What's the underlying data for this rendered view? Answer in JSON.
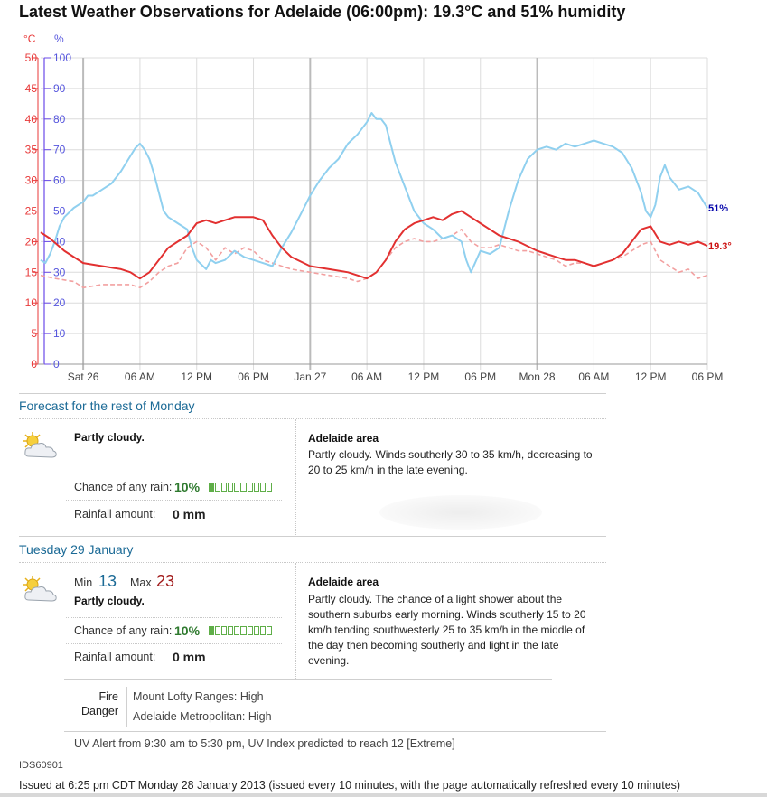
{
  "title": "Latest Weather Observations for Adelaide (06:00pm): 19.3°C and 51% humidity",
  "chart_data": {
    "type": "line",
    "y_left": {
      "unit": "°C",
      "ticks": [
        0,
        5,
        10,
        15,
        20,
        25,
        30,
        35,
        40,
        45,
        50
      ],
      "range": [
        0,
        50
      ],
      "color": "#e83a3a"
    },
    "y_right": {
      "unit": "%",
      "ticks": [
        0,
        10,
        20,
        30,
        40,
        50,
        60,
        70,
        80,
        90,
        100
      ],
      "range": [
        0,
        100
      ],
      "color": "#5555dd"
    },
    "x_unit": "hours since Sat 26 00:00",
    "x_range": [
      -4.5,
      66
    ],
    "x_ticks": [
      {
        "h": 0,
        "label": "Sat 26"
      },
      {
        "h": 6,
        "label": "06 AM"
      },
      {
        "h": 12,
        "label": "12 PM"
      },
      {
        "h": 18,
        "label": "06 PM"
      },
      {
        "h": 24,
        "label": "Jan 27"
      },
      {
        "h": 30,
        "label": "06 AM"
      },
      {
        "h": 36,
        "label": "12 PM"
      },
      {
        "h": 42,
        "label": "06 PM"
      },
      {
        "h": 48,
        "label": "Mon 28"
      },
      {
        "h": 54,
        "label": "06 AM"
      },
      {
        "h": 60,
        "label": "12 PM"
      },
      {
        "h": 66,
        "label": "06 PM"
      }
    ],
    "grid": true,
    "end_labels": {
      "humidity": "51%",
      "temperature": "19.3°"
    },
    "series": [
      {
        "axis": "left",
        "color": "#e23030",
        "style": "solid",
        "points": [
          [
            -4.5,
            21.5
          ],
          [
            -3.5,
            20.5
          ],
          [
            -2,
            18.5
          ],
          [
            0,
            16.5
          ],
          [
            2,
            16
          ],
          [
            4,
            15.5
          ],
          [
            5,
            15
          ],
          [
            6,
            14
          ],
          [
            7,
            15
          ],
          [
            8,
            17
          ],
          [
            9,
            19
          ],
          [
            10,
            20
          ],
          [
            11,
            21
          ],
          [
            12,
            23
          ],
          [
            13,
            23.5
          ],
          [
            14,
            23
          ],
          [
            15,
            23.5
          ],
          [
            16,
            24
          ],
          [
            17,
            24
          ],
          [
            18,
            24
          ],
          [
            19,
            23.5
          ],
          [
            20,
            21
          ],
          [
            21,
            19
          ],
          [
            22,
            17.5
          ],
          [
            24,
            16
          ],
          [
            26,
            15.5
          ],
          [
            28,
            15
          ],
          [
            30,
            14
          ],
          [
            31,
            15
          ],
          [
            32,
            17
          ],
          [
            33,
            20
          ],
          [
            34,
            22
          ],
          [
            35,
            23
          ],
          [
            36,
            23.5
          ],
          [
            37,
            24
          ],
          [
            38,
            23.5
          ],
          [
            39,
            24.5
          ],
          [
            40,
            25
          ],
          [
            41,
            24
          ],
          [
            42,
            23
          ],
          [
            43,
            22
          ],
          [
            44,
            21
          ],
          [
            46,
            20
          ],
          [
            48,
            18.5
          ],
          [
            49,
            18
          ],
          [
            50,
            17.5
          ],
          [
            51,
            17
          ],
          [
            52,
            17
          ],
          [
            53,
            16.5
          ],
          [
            54,
            16
          ],
          [
            55,
            16.5
          ],
          [
            56,
            17
          ],
          [
            57,
            18
          ],
          [
            58,
            20
          ],
          [
            59,
            22
          ],
          [
            60,
            22.5
          ],
          [
            61,
            20
          ],
          [
            62,
            19.5
          ],
          [
            63,
            20
          ],
          [
            64,
            19.5
          ],
          [
            65,
            20
          ],
          [
            66,
            19.3
          ]
        ]
      },
      {
        "axis": "left",
        "color": "#f2a0a0",
        "style": "dashed",
        "points": [
          [
            -4.5,
            14.5
          ],
          [
            -3,
            14
          ],
          [
            -1,
            13.5
          ],
          [
            0,
            12.5
          ],
          [
            2,
            13
          ],
          [
            4,
            13
          ],
          [
            5,
            13
          ],
          [
            6,
            12.5
          ],
          [
            7,
            13.5
          ],
          [
            8,
            15
          ],
          [
            9,
            16
          ],
          [
            10,
            16.5
          ],
          [
            11,
            19
          ],
          [
            12,
            20
          ],
          [
            13,
            19
          ],
          [
            14,
            17
          ],
          [
            15,
            19
          ],
          [
            16,
            18
          ],
          [
            17,
            19
          ],
          [
            18,
            18.5
          ],
          [
            19,
            17
          ],
          [
            20,
            16.5
          ],
          [
            21,
            16
          ],
          [
            22,
            15.5
          ],
          [
            24,
            15
          ],
          [
            26,
            14.5
          ],
          [
            28,
            14
          ],
          [
            29,
            13.5
          ],
          [
            30,
            14
          ],
          [
            31,
            15
          ],
          [
            32,
            17
          ],
          [
            33,
            19
          ],
          [
            34,
            20
          ],
          [
            35,
            20.5
          ],
          [
            36,
            20
          ],
          [
            37,
            20
          ],
          [
            38,
            20.5
          ],
          [
            39,
            21
          ],
          [
            40,
            22
          ],
          [
            41,
            20
          ],
          [
            42,
            19
          ],
          [
            43,
            19
          ],
          [
            44,
            19.5
          ],
          [
            45,
            19
          ],
          [
            46,
            18.5
          ],
          [
            47,
            18.5
          ],
          [
            48,
            18
          ],
          [
            49,
            17.5
          ],
          [
            50,
            17
          ],
          [
            51,
            16
          ],
          [
            52,
            16.5
          ],
          [
            53,
            16.5
          ],
          [
            54,
            16
          ],
          [
            55,
            16.5
          ],
          [
            56,
            17
          ],
          [
            57,
            17.5
          ],
          [
            58,
            18.5
          ],
          [
            59,
            19.5
          ],
          [
            60,
            20
          ],
          [
            61,
            17
          ],
          [
            62,
            16
          ],
          [
            63,
            15
          ],
          [
            64,
            15.5
          ],
          [
            65,
            14
          ],
          [
            66,
            14.5
          ]
        ]
      },
      {
        "axis": "right",
        "color": "#90d0ef",
        "style": "solid",
        "points": [
          [
            -4.5,
            34
          ],
          [
            -4,
            33
          ],
          [
            -3.5,
            36
          ],
          [
            -3,
            40
          ],
          [
            -2.5,
            45
          ],
          [
            -2,
            48
          ],
          [
            -1,
            51
          ],
          [
            0,
            53
          ],
          [
            0.5,
            55
          ],
          [
            1,
            55
          ],
          [
            2,
            57
          ],
          [
            3,
            59
          ],
          [
            4,
            63
          ],
          [
            5,
            68
          ],
          [
            5.5,
            70.5
          ],
          [
            6,
            72
          ],
          [
            6.5,
            70
          ],
          [
            7,
            67
          ],
          [
            7.5,
            62
          ],
          [
            8,
            56
          ],
          [
            8.5,
            50
          ],
          [
            9,
            48
          ],
          [
            10,
            46
          ],
          [
            11,
            44
          ],
          [
            11.5,
            38
          ],
          [
            12,
            34
          ],
          [
            13,
            31
          ],
          [
            13.5,
            34
          ],
          [
            14,
            33
          ],
          [
            15,
            34
          ],
          [
            16,
            37
          ],
          [
            17,
            35
          ],
          [
            18,
            34
          ],
          [
            19,
            33
          ],
          [
            20,
            32
          ],
          [
            21,
            38
          ],
          [
            22,
            43
          ],
          [
            23,
            49
          ],
          [
            24,
            55
          ],
          [
            25,
            60
          ],
          [
            26,
            64
          ],
          [
            27,
            67
          ],
          [
            28,
            72
          ],
          [
            29,
            75
          ],
          [
            30,
            79
          ],
          [
            30.5,
            82
          ],
          [
            31,
            80
          ],
          [
            31.5,
            80
          ],
          [
            32,
            78
          ],
          [
            32.5,
            72
          ],
          [
            33,
            66
          ],
          [
            34,
            58
          ],
          [
            35,
            50
          ],
          [
            36,
            46
          ],
          [
            37,
            44
          ],
          [
            38,
            41
          ],
          [
            39,
            42
          ],
          [
            40,
            40
          ],
          [
            40.5,
            34
          ],
          [
            41,
            30
          ],
          [
            42,
            37
          ],
          [
            43,
            36
          ],
          [
            44,
            38
          ],
          [
            45,
            50
          ],
          [
            46,
            60
          ],
          [
            47,
            67
          ],
          [
            48,
            70
          ],
          [
            49,
            71
          ],
          [
            50,
            70
          ],
          [
            51,
            72
          ],
          [
            52,
            71
          ],
          [
            53,
            72
          ],
          [
            54,
            73
          ],
          [
            55,
            72
          ],
          [
            56,
            71
          ],
          [
            57,
            69
          ],
          [
            58,
            64
          ],
          [
            59,
            56
          ],
          [
            59.5,
            50
          ],
          [
            60,
            48
          ],
          [
            60.5,
            52
          ],
          [
            61,
            61
          ],
          [
            61.5,
            65
          ],
          [
            62,
            61
          ],
          [
            63,
            57
          ],
          [
            64,
            58
          ],
          [
            65,
            56
          ],
          [
            66,
            51
          ]
        ]
      }
    ]
  },
  "forecast": {
    "monday": {
      "heading": "Forecast for the rest of Monday",
      "icon": "partly-cloudy-icon",
      "summary": "Partly cloudy.",
      "rain_chance_label": "Chance of any rain:",
      "rain_chance": "10%",
      "rain_chance_fraction": 0.1,
      "rain_amount_label": "Rainfall amount:",
      "rain_amount": "0 mm",
      "area_title": "Adelaide area",
      "area_text": "Partly cloudy. Winds southerly 30 to 35 km/h, decreasing to 20 to 25 km/h in the late evening."
    },
    "tuesday": {
      "heading": "Tuesday 29 January",
      "icon": "partly-cloudy-icon",
      "min_label": "Min",
      "min": "13",
      "max_label": "Max",
      "max": "23",
      "summary": "Partly cloudy.",
      "rain_chance_label": "Chance of any rain:",
      "rain_chance": "10%",
      "rain_chance_fraction": 0.1,
      "rain_amount_label": "Rainfall amount:",
      "rain_amount": "0 mm",
      "area_title": "Adelaide area",
      "area_text": "Partly cloudy. The chance of a light shower about the southern suburbs early morning. Winds southerly 15 to 20 km/h tending southwesterly 25 to 35 km/h in the middle of the day then becoming southerly and light in the late evening."
    }
  },
  "fire_danger": {
    "label_line1": "Fire",
    "label_line2": "Danger",
    "rows": [
      "Mount Lofty Ranges: High",
      "Adelaide Metropolitan: High"
    ]
  },
  "uv_alert": "UV Alert from 9:30 am to 5:30 pm, UV Index predicted to reach 12 [Extreme]",
  "product_id": "IDS60901",
  "issued": "Issued at 6:25 pm CDT Monday 28 January 2013 (issued every 10 minutes, with the page automatically refreshed every 10 minutes)"
}
